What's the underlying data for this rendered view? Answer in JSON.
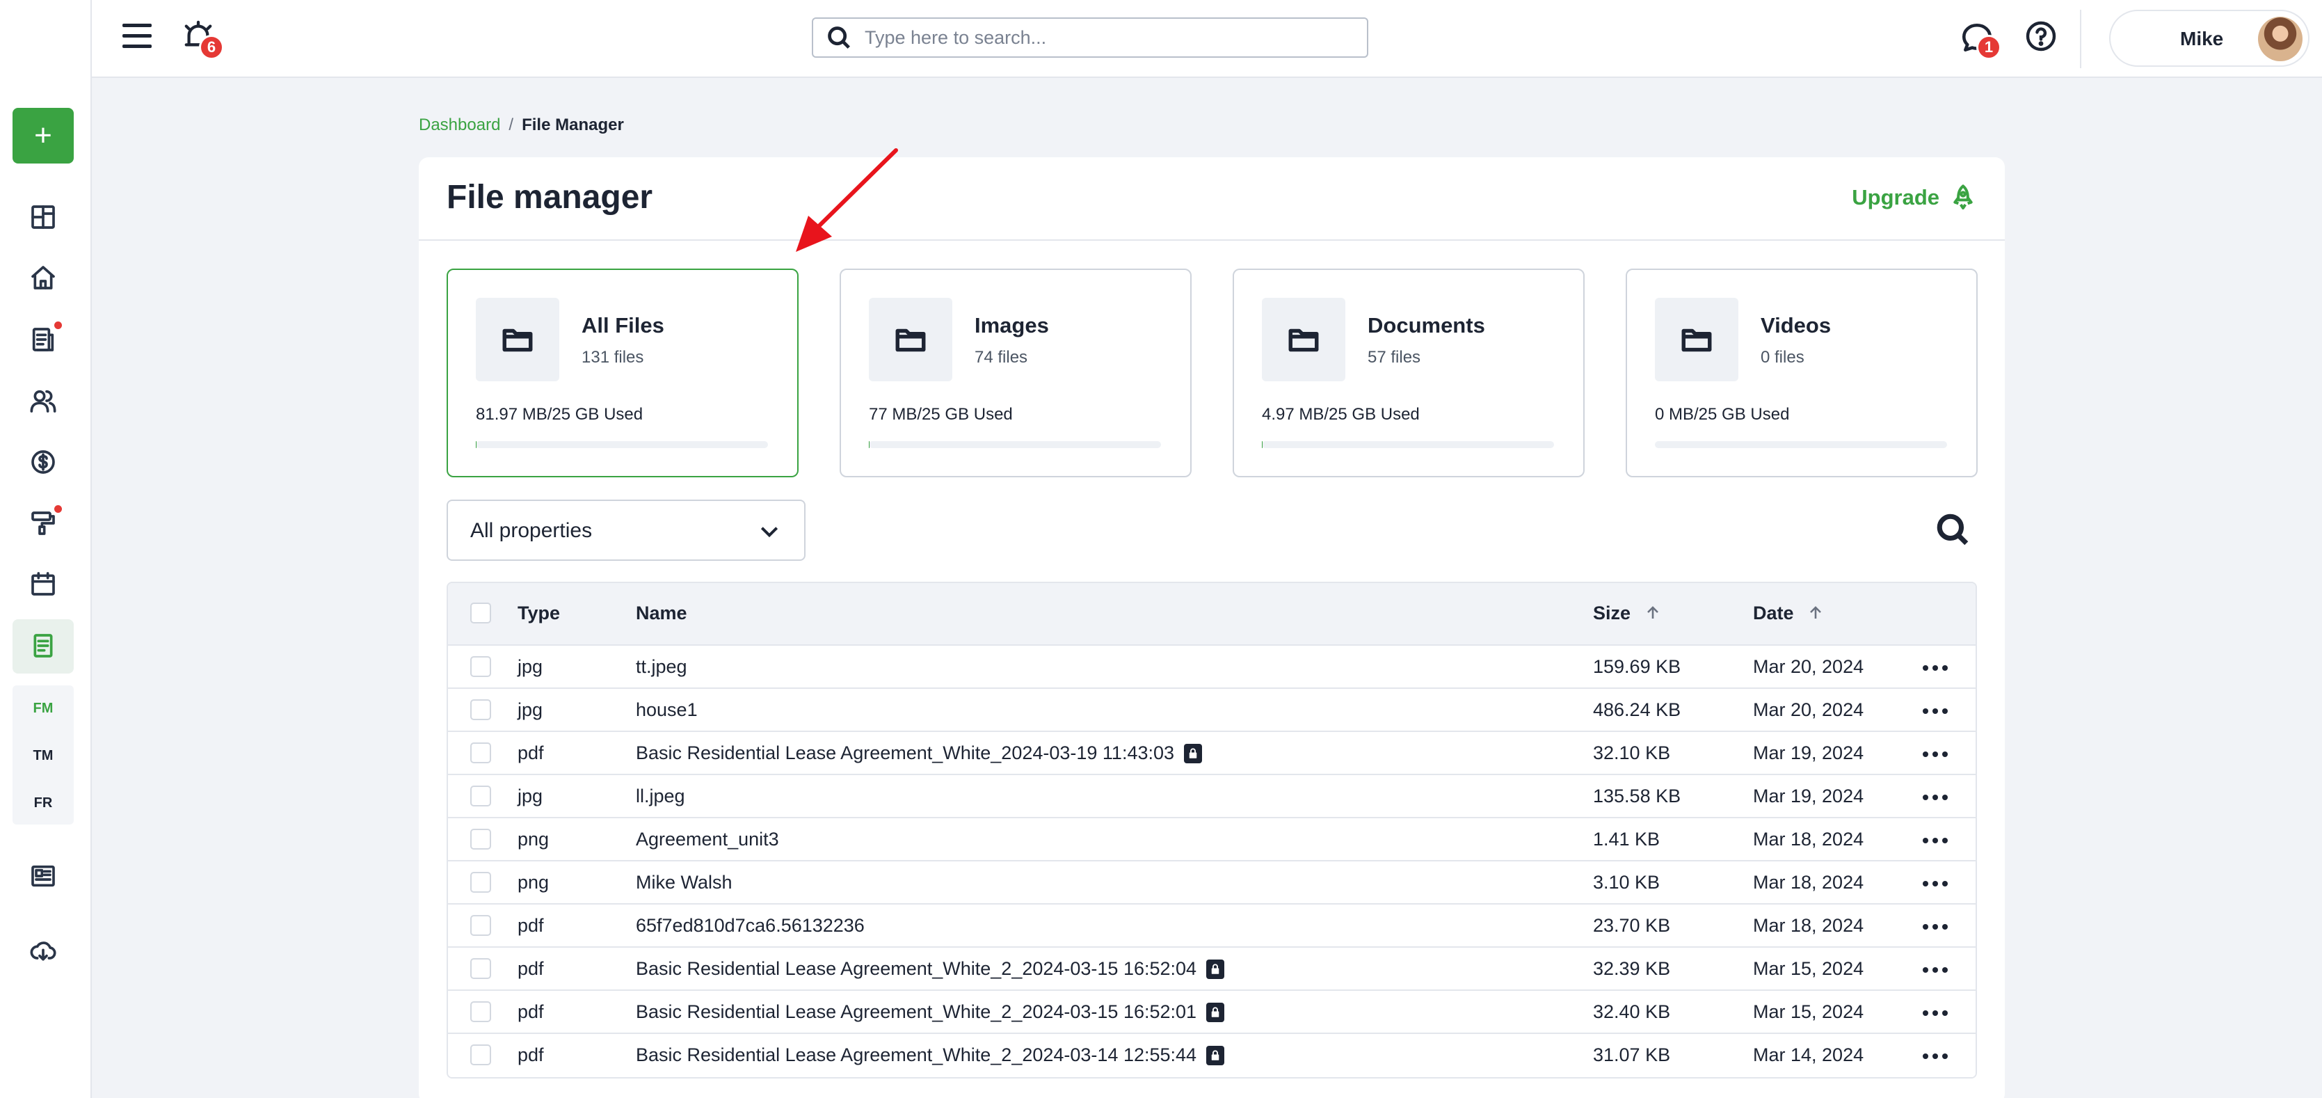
{
  "sidebar": {
    "add_label": "+",
    "items": [
      {
        "name": "dashboard",
        "icon": "grid-icon"
      },
      {
        "name": "properties",
        "icon": "home-icon"
      },
      {
        "name": "reports",
        "icon": "document-icon"
      },
      {
        "name": "tenants",
        "icon": "users-icon"
      },
      {
        "name": "payments",
        "icon": "dollar-icon"
      },
      {
        "name": "maintenance",
        "icon": "paint-roller-icon"
      },
      {
        "name": "calendar",
        "icon": "calendar-icon"
      },
      {
        "name": "files",
        "icon": "file-text-icon"
      },
      {
        "name": "listings",
        "icon": "newspaper-icon"
      },
      {
        "name": "downloads",
        "icon": "cloud-download-icon"
      }
    ],
    "subnav": [
      {
        "label": "FM",
        "active": true
      },
      {
        "label": "TM",
        "active": false
      },
      {
        "label": "FR",
        "active": false
      }
    ]
  },
  "topbar": {
    "alarm_count": "6",
    "search_placeholder": "Type here to search...",
    "chat_count": "1",
    "user_name": "Mike"
  },
  "breadcrumb": {
    "link": "Dashboard",
    "separator": "/",
    "current": "File Manager"
  },
  "page": {
    "title": "File manager",
    "upgrade_label": "Upgrade"
  },
  "storage_cards": [
    {
      "title": "All Files",
      "count": "131 files",
      "used": "81.97 MB/25 GB Used",
      "fraction": 0.0033,
      "selected": true
    },
    {
      "title": "Images",
      "count": "74 files",
      "used": "77 MB/25 GB Used",
      "fraction": 0.0031,
      "selected": false
    },
    {
      "title": "Documents",
      "count": "57 files",
      "used": "4.97 MB/25 GB Used",
      "fraction": 0.0002,
      "selected": false
    },
    {
      "title": "Videos",
      "count": "0 files",
      "used": "0 MB/25 GB Used",
      "fraction": 0,
      "selected": false
    }
  ],
  "filter": {
    "selected": "All properties"
  },
  "table": {
    "headers": {
      "type": "Type",
      "name": "Name",
      "size": "Size",
      "date": "Date"
    },
    "rows": [
      {
        "type": "jpg",
        "name": "tt.jpeg",
        "size": "159.69 KB",
        "date": "Mar 20, 2024",
        "locked": false
      },
      {
        "type": "jpg",
        "name": "house1",
        "size": "486.24 KB",
        "date": "Mar 20, 2024",
        "locked": false
      },
      {
        "type": "pdf",
        "name": "Basic Residential Lease Agreement_White_2024-03-19 11:43:03",
        "size": "32.10 KB",
        "date": "Mar 19, 2024",
        "locked": true
      },
      {
        "type": "jpg",
        "name": "ll.jpeg",
        "size": "135.58 KB",
        "date": "Mar 19, 2024",
        "locked": false
      },
      {
        "type": "png",
        "name": "Agreement_unit3",
        "size": "1.41 KB",
        "date": "Mar 18, 2024",
        "locked": false
      },
      {
        "type": "png",
        "name": "Mike Walsh",
        "size": "3.10 KB",
        "date": "Mar 18, 2024",
        "locked": false
      },
      {
        "type": "pdf",
        "name": "65f7ed810d7ca6.56132236",
        "size": "23.70 KB",
        "date": "Mar 18, 2024",
        "locked": false
      },
      {
        "type": "pdf",
        "name": "Basic Residential Lease Agreement_White_2_2024-03-15 16:52:04",
        "size": "32.39 KB",
        "date": "Mar 15, 2024",
        "locked": true
      },
      {
        "type": "pdf",
        "name": "Basic Residential Lease Agreement_White_2_2024-03-15 16:52:01",
        "size": "32.40 KB",
        "date": "Mar 15, 2024",
        "locked": true
      },
      {
        "type": "pdf",
        "name": "Basic Residential Lease Agreement_White_2_2024-03-14 12:55:44",
        "size": "31.07 KB",
        "date": "Mar 14, 2024",
        "locked": true
      }
    ]
  },
  "colors": {
    "accent": "#3aa342",
    "badge": "#e53935",
    "annotation": "#e8141c"
  }
}
